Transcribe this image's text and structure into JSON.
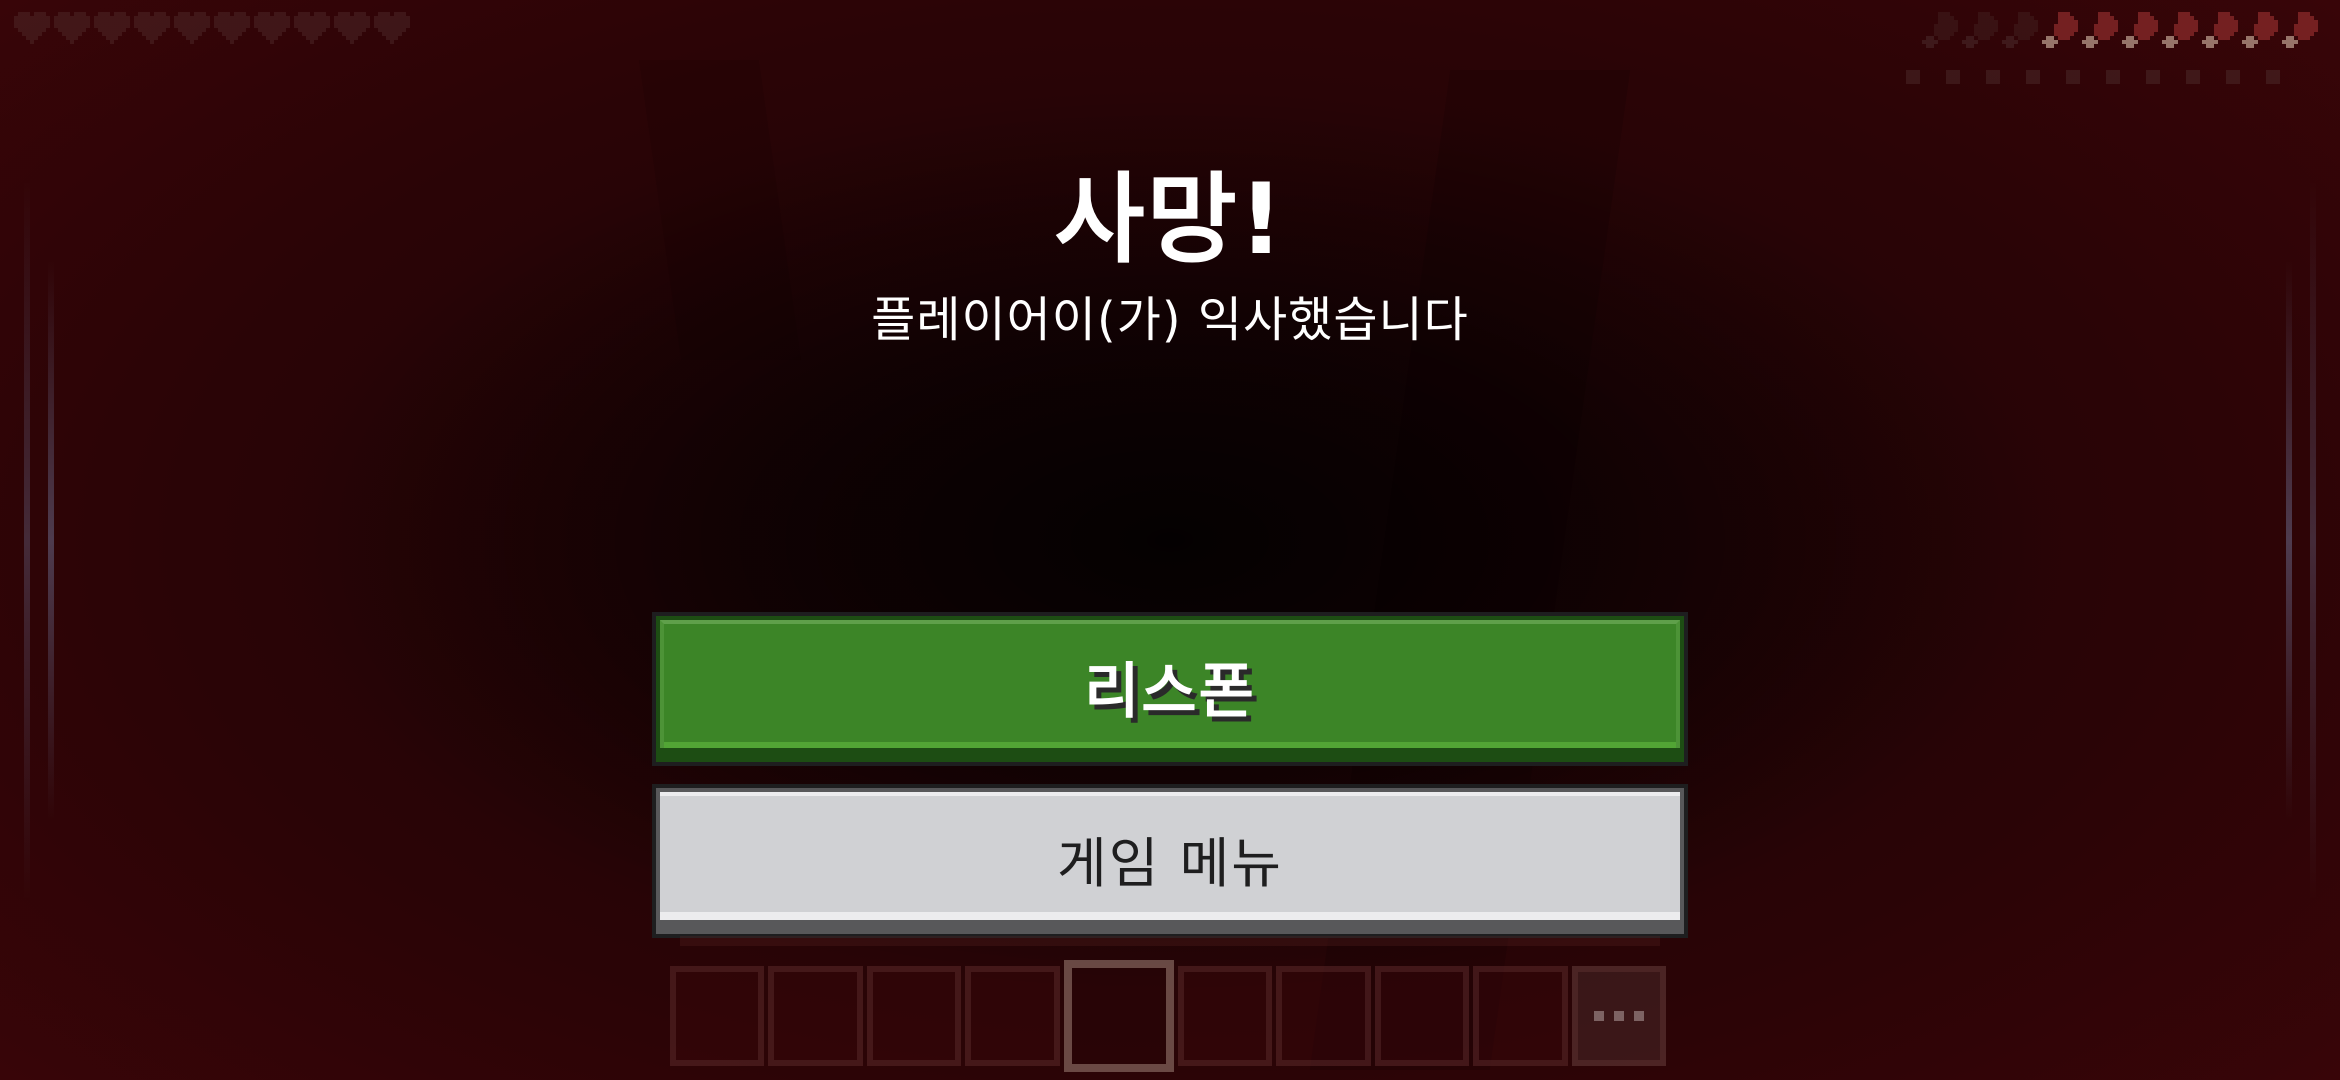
{
  "screen": {
    "title": "사망!",
    "subtitle": "플레이어이(가) 익사했습니다"
  },
  "buttons": {
    "respawn_label": "리스폰",
    "menu_label": "게임 메뉴"
  },
  "hud": {
    "hearts_filled": 0,
    "hearts_total": 10,
    "hunger_filled": 7,
    "hunger_total": 10,
    "hotbar_slots": 9,
    "hotbar_selected_slot": 5
  },
  "colors": {
    "respawn_green": "#3c8527",
    "menu_gray": "#d0d1d4",
    "overlay_red": "#2a0406"
  },
  "icons": [
    "heart-icon",
    "hunger-drumstick-icon",
    "more-items-icon"
  ]
}
